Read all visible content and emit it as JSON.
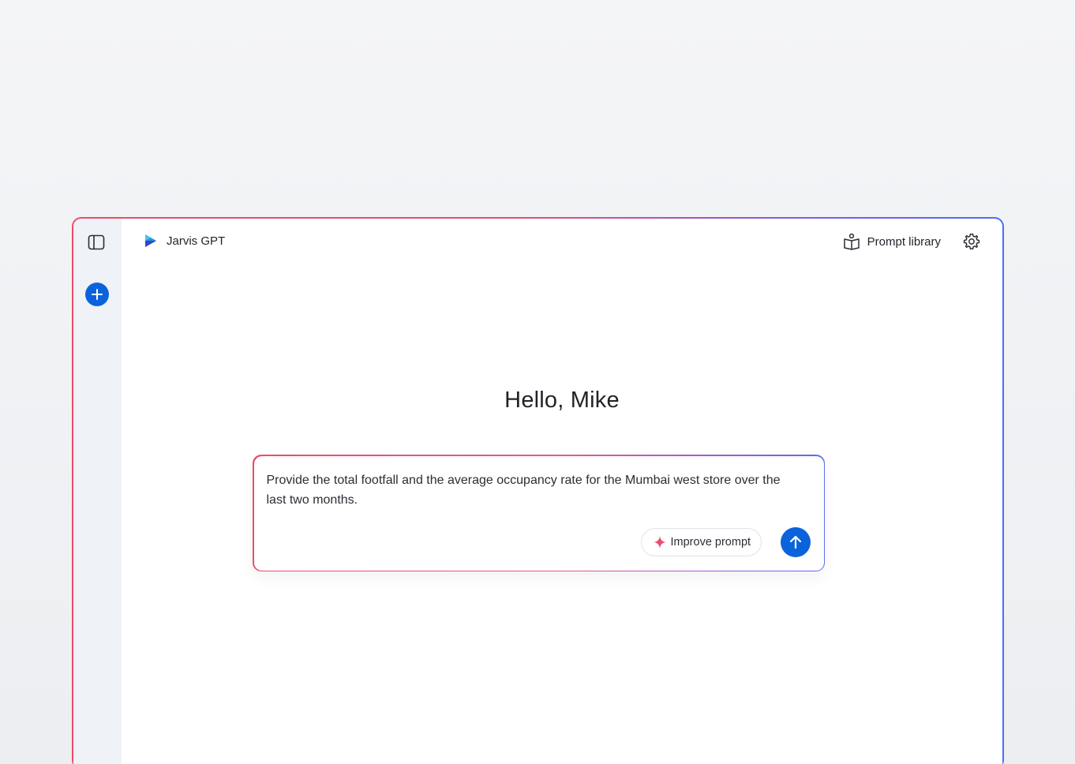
{
  "app": {
    "brand_name": "Jarvis GPT",
    "brand_colors": [
      "#1d9bd8",
      "#3b3fd6"
    ],
    "accent": "#0b63db"
  },
  "sidebar": {
    "toggle_icon": "sidebar-panel-icon",
    "new_chat_icon": "plus-icon"
  },
  "header": {
    "prompt_library_label": "Prompt library",
    "prompt_library_icon": "book-user-icon",
    "settings_icon": "gear-icon"
  },
  "main": {
    "greeting": "Hello, Mike"
  },
  "composer": {
    "value": "Provide the total footfall and the average occupancy rate for the Mumbai west store over the last two months.",
    "improve_label": "Improve prompt",
    "improve_icon": "sparkle-icon",
    "send_icon": "arrow-up-icon"
  }
}
